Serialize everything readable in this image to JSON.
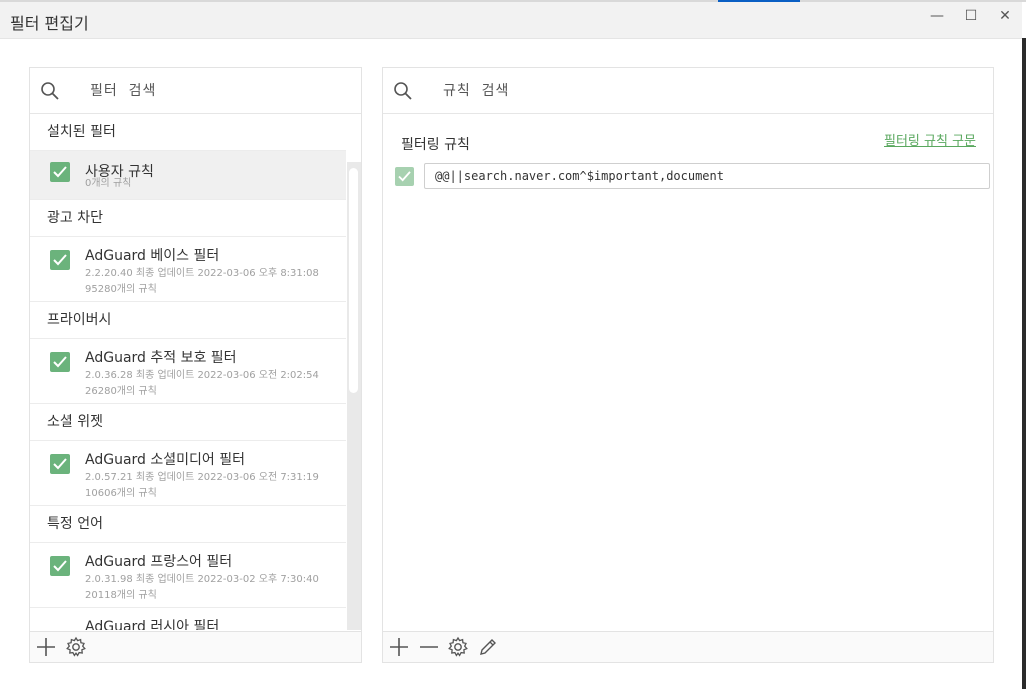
{
  "window": {
    "title": "필터 편집기",
    "minimize": "—",
    "maximize": "☐",
    "close": "✕"
  },
  "filters_panel": {
    "search_placeholder": "필터  검색",
    "installed_header": "설치된 필터",
    "user_rules": {
      "name": "사용자 규칙",
      "count": "0개의 규칙",
      "checked": true
    },
    "groups": [
      {
        "header": "광고 차단",
        "items": [
          {
            "name": "AdGuard 베이스 필터",
            "version_line": "2.2.20.40 최종 업데이트 2022-03-06 오후 8:31:08",
            "count": "95280개의 규칙",
            "checked": true
          }
        ]
      },
      {
        "header": "프라이버시",
        "items": [
          {
            "name": "AdGuard 추적 보호 필터",
            "version_line": "2.0.36.28 최종 업데이트 2022-03-06 오전 2:02:54",
            "count": "26280개의 규칙",
            "checked": true
          }
        ]
      },
      {
        "header": "소셜 위젯",
        "items": [
          {
            "name": "AdGuard 소셜미디어 필터",
            "version_line": "2.0.57.21 최종 업데이트 2022-03-06 오전 7:31:19",
            "count": "10606개의 규칙",
            "checked": true
          }
        ]
      },
      {
        "header": "특정 언어",
        "items": [
          {
            "name": "AdGuard 프랑스어 필터",
            "version_line": "2.0.31.98 최종 업데이트 2022-03-02 오후 7:30:40",
            "count": "20118개의 규칙",
            "checked": true
          },
          {
            "name": "AdGuard 러시아 필터",
            "version_line": "",
            "count": "",
            "checked": true
          }
        ]
      }
    ]
  },
  "rules_panel": {
    "search_placeholder": "규칙  검색",
    "title": "필터링 규칙",
    "syntax_link": "필터링 규칙 구문",
    "rule_value": "@@||search.naver.com^$important,document"
  },
  "colors": {
    "checkbox_green": "#6bb37c",
    "link_green": "#5aa85f"
  }
}
